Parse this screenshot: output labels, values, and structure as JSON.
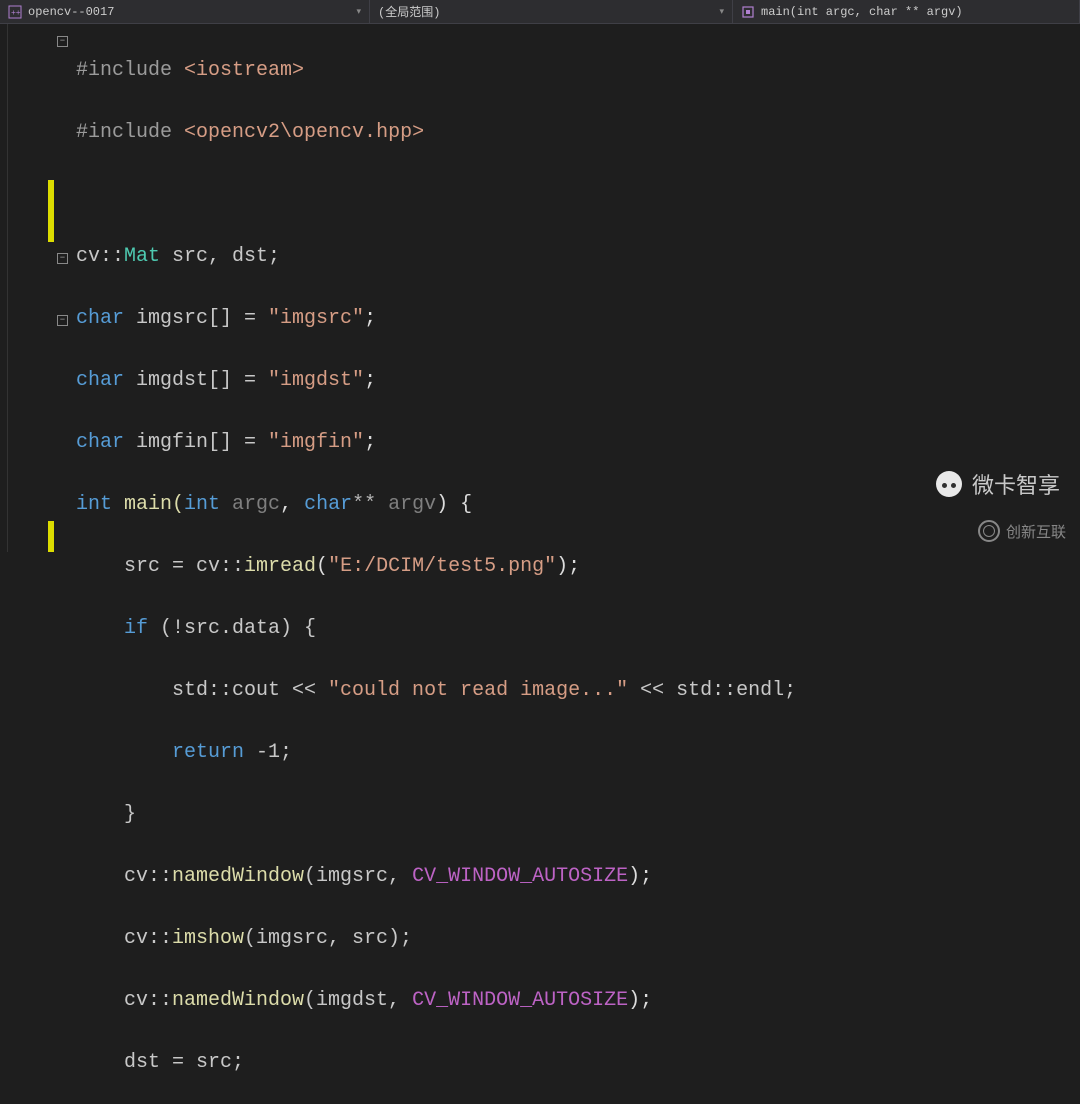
{
  "toolbar": {
    "project": "opencv--0017",
    "scope": "(全局范围)",
    "symbol": "main(int argc, char ** argv)"
  },
  "code": {
    "l1": {
      "pp": "#include ",
      "inc": "<iostream>"
    },
    "l2": {
      "pp": "#include ",
      "inc": "<opencv2\\opencv.hpp>"
    },
    "l3": "",
    "l4": {
      "a": "cv::",
      "b": "Mat",
      "c": " src, dst;"
    },
    "l5": {
      "a": "char",
      "b": " imgsrc[] = ",
      "c": "\"imgsrc\"",
      "d": ";"
    },
    "l6": {
      "a": "char",
      "b": " imgdst[] = ",
      "c": "\"imgdst\"",
      "d": ";"
    },
    "l7": {
      "a": "char",
      "b": " imgfin[] = ",
      "c": "\"imgfin\"",
      "d": ";"
    },
    "l8": {
      "a": "int",
      "b": " main(",
      "c": "int",
      "d": " argc",
      "e": ", ",
      "f": "char",
      "g": "**",
      "h": " argv",
      "i": ") {"
    },
    "l9": {
      "a": "    src = cv::",
      "b": "imread",
      "c": "(",
      "d": "\"E:/DCIM/test5.png\"",
      "e": ");"
    },
    "l10": {
      "a": "    ",
      "b": "if",
      "c": " (!src.data) {"
    },
    "l11": {
      "a": "        std::cout << ",
      "b": "\"could not read image...\"",
      "c": " << std::endl;"
    },
    "l12": {
      "a": "        ",
      "b": "return",
      "c": " -1;"
    },
    "l13": {
      "a": "    }"
    },
    "l14": {
      "a": "    cv::",
      "b": "namedWindow",
      "c": "(imgsrc, ",
      "d": "CV_WINDOW_AUTOSIZE",
      "e": ");"
    },
    "l15": {
      "a": "    cv::",
      "b": "imshow",
      "c": "(imgsrc, src);"
    },
    "l16": {
      "a": "    cv::",
      "b": "namedWindow",
      "c": "(imgdst, ",
      "d": "CV_WINDOW_AUTOSIZE",
      "e": ");"
    },
    "l17": {
      "a": "    dst = src;"
    }
  },
  "watermark1": "微卡智享",
  "watermark2": "创新互联"
}
